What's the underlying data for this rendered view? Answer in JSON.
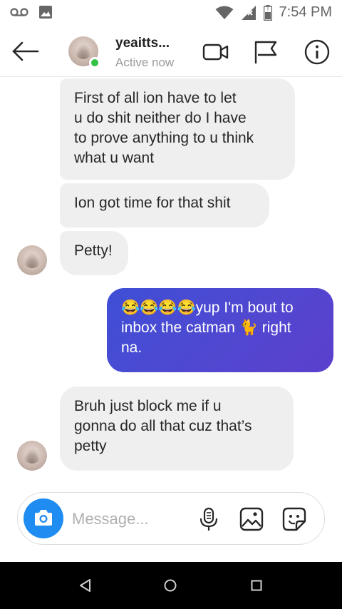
{
  "status_bar": {
    "time": "7:54 PM",
    "icons": [
      "voicemail-icon",
      "image-icon",
      "wifi-icon",
      "signal-icon",
      "battery-icon"
    ]
  },
  "header": {
    "user_name": "yeaitts...",
    "user_status": "Active now",
    "icons": [
      "back-arrow-icon",
      "video-call-icon",
      "flag-icon",
      "info-icon"
    ],
    "online_color": "#2fc246"
  },
  "messages": [
    {
      "sender": "them",
      "text_lines": [
        "First of all ion have to let",
        "u do shit neither do I have",
        "to prove anything to u think",
        "what u want"
      ]
    },
    {
      "sender": "them",
      "text_lines": [
        "Ion got time for that shit"
      ]
    },
    {
      "sender": "them",
      "text_lines": [
        "Petty!"
      ]
    },
    {
      "sender": "me",
      "text_lines": [
        "😂😂😂😂yup I'm bout to",
        "inbox the catman 🐈 right",
        "na."
      ]
    },
    {
      "sender": "them",
      "text_lines": [
        "Bruh just block me if u",
        "gonna do all that cuz that’s",
        "petty"
      ]
    }
  ],
  "composer": {
    "placeholder": "Message...",
    "icons": [
      "camera-icon",
      "microphone-icon",
      "gallery-icon",
      "sticker-icon"
    ],
    "camera_color": "#1e8cf0"
  },
  "nav_bar": {
    "icons": [
      "back-triangle-icon",
      "home-circle-icon",
      "recents-square-icon"
    ]
  },
  "colors": {
    "incoming_bubble": "#efefef",
    "outgoing_bubble_start": "#3e4fd6",
    "outgoing_bubble_end": "#5b3fcd"
  }
}
